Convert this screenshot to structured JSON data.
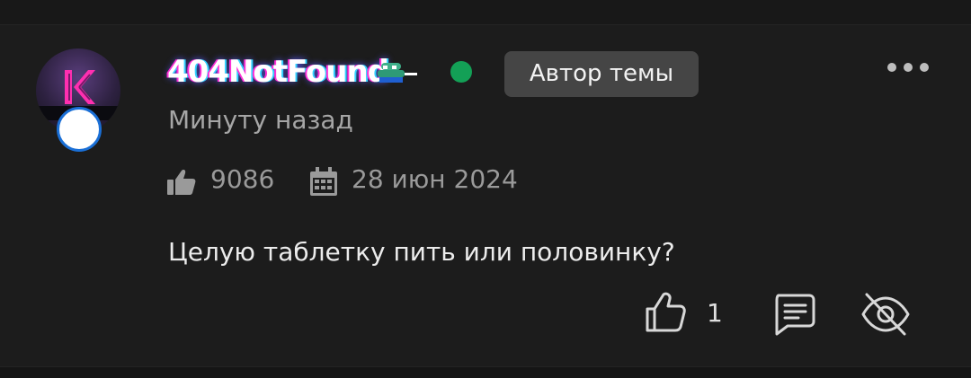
{
  "post": {
    "author": {
      "name": "404NotFound",
      "avatar_letter": "K",
      "online": true,
      "badge": "Автор темы"
    },
    "time": "Минуту назад",
    "stats": {
      "likes": "9086",
      "registered": "28 июн 2024"
    },
    "message": "Целую таблетку пить или половинку?",
    "actions": {
      "like_count": "1"
    }
  },
  "colors": {
    "background": "#1c1c1c",
    "badge_background": "#454545",
    "online": "#13a056",
    "muted_text": "#a6a6a6"
  },
  "icons": [
    "more-icon",
    "thumbs-up-icon",
    "calendar-icon",
    "reply-icon",
    "eye-off-icon",
    "pepe-icon"
  ]
}
